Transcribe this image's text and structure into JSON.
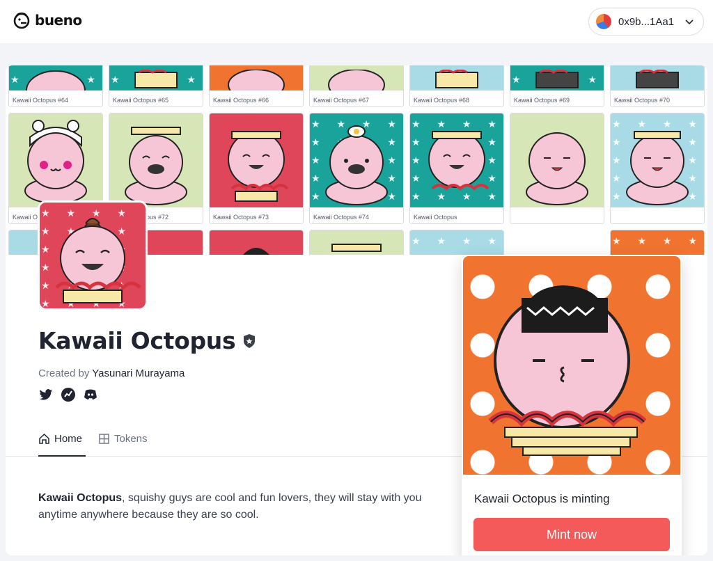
{
  "header": {
    "brand": "bueno",
    "wallet_address": "0x9b...1Aa1"
  },
  "banner": {
    "row0": [
      "Kawaii Octopus #64",
      "Kawaii Octopus #65",
      "Kawaii Octopus #66",
      "Kawaii Octopus #67",
      "Kawaii Octopus #68",
      "Kawaii Octopus #69",
      "Kawaii Octopus #70"
    ],
    "row1": [
      "Kawaii O",
      "Kawaii Octopus #72",
      "Kawaii Octopus #73",
      "Kawaii Octopus #74",
      "Kawaii Octopus"
    ],
    "tile_colors": {
      "teal": "#1aa39a",
      "green": "#d6e6b6",
      "red": "#e0465a",
      "orange": "#f0742f",
      "blue": "#a8dbe6"
    }
  },
  "collection": {
    "title": "Kawaii Octopus",
    "created_by_label": "Created by",
    "creator": "Yasunari Murayama",
    "socials": [
      "twitter-icon",
      "stats-icon",
      "discord-icon"
    ]
  },
  "tabs": [
    {
      "label": "Home",
      "icon": "home-icon",
      "active": true
    },
    {
      "label": "Tokens",
      "icon": "grid-icon",
      "active": false
    }
  ],
  "description": {
    "bold": "Kawaii Octopus",
    "rest": ", squishy guys are cool and fun lovers, they will stay with you anytime anywhere because they are so cool."
  },
  "mint": {
    "status": "Kawaii Octopus is minting",
    "button": "Mint now"
  },
  "colors": {
    "accent": "#f55a5a",
    "text": "#1f2430"
  }
}
